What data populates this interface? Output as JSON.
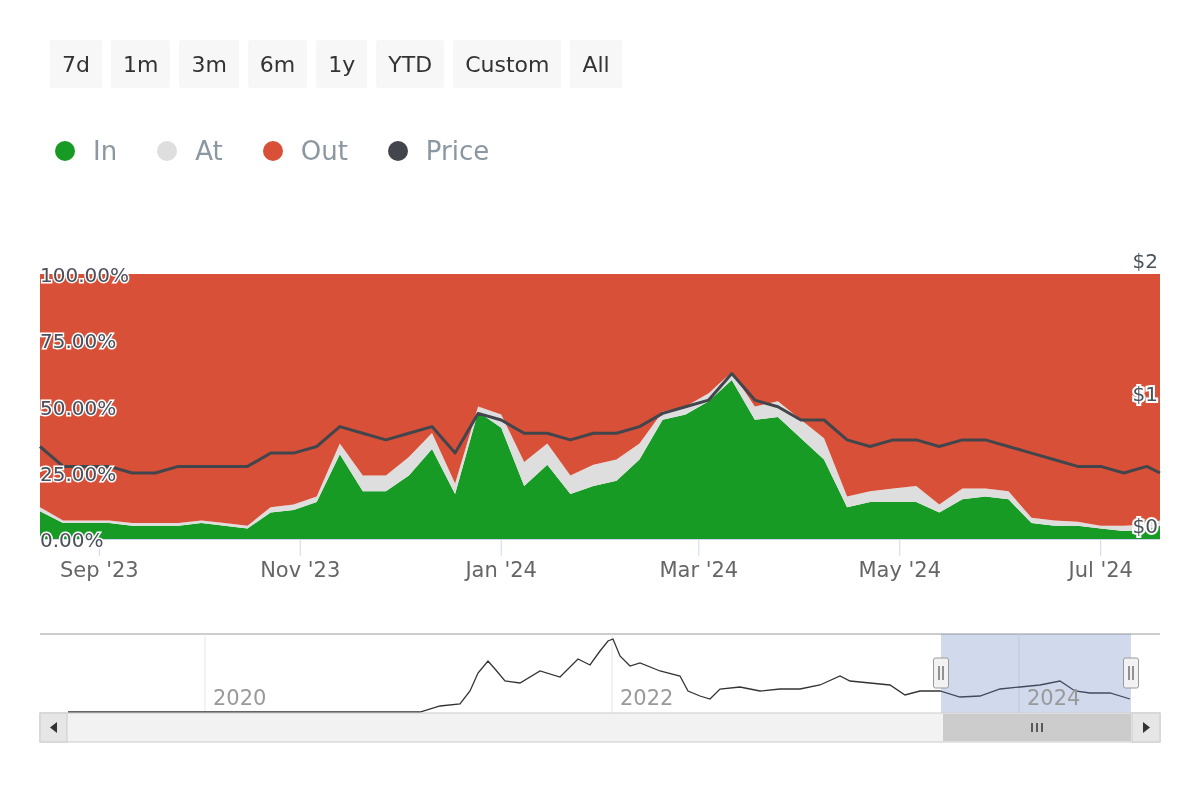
{
  "range_buttons": [
    {
      "label": "7d",
      "selected": false
    },
    {
      "label": "1m",
      "selected": false
    },
    {
      "label": "3m",
      "selected": false
    },
    {
      "label": "6m",
      "selected": false
    },
    {
      "label": "1y",
      "selected": false
    },
    {
      "label": "YTD",
      "selected": false
    },
    {
      "label": "Custom",
      "selected": false
    },
    {
      "label": "All",
      "selected": false
    }
  ],
  "chart": {
    "chart_data": {
      "type": "area",
      "stacked": true,
      "x": [
        "2023-08-14",
        "2023-08-21",
        "2023-08-28",
        "2023-09-04",
        "2023-09-11",
        "2023-09-18",
        "2023-09-25",
        "2023-10-02",
        "2023-10-09",
        "2023-10-16",
        "2023-10-23",
        "2023-10-30",
        "2023-11-06",
        "2023-11-13",
        "2023-11-20",
        "2023-11-27",
        "2023-12-04",
        "2023-12-11",
        "2023-12-18",
        "2023-12-25",
        "2024-01-01",
        "2024-01-08",
        "2024-01-15",
        "2024-01-22",
        "2024-01-29",
        "2024-02-05",
        "2024-02-12",
        "2024-02-19",
        "2024-02-26",
        "2024-03-04",
        "2024-03-11",
        "2024-03-18",
        "2024-03-25",
        "2024-04-01",
        "2024-04-08",
        "2024-04-15",
        "2024-04-22",
        "2024-04-29",
        "2024-05-06",
        "2024-05-13",
        "2024-05-20",
        "2024-05-27",
        "2024-06-03",
        "2024-06-10",
        "2024-06-17",
        "2024-06-24",
        "2024-07-01",
        "2024-07-08",
        "2024-07-15",
        "2024-07-19"
      ],
      "series": [
        {
          "name": "In",
          "color": "#189b24",
          "values": [
            10.5,
            6,
            6,
            6,
            5,
            5,
            5,
            6,
            5,
            4,
            10,
            11,
            14,
            32,
            18,
            18,
            24,
            34,
            17,
            48,
            42,
            20,
            28,
            17,
            20,
            22,
            30,
            45,
            47,
            52,
            60,
            45,
            46,
            38,
            30,
            12,
            14,
            14,
            14,
            10,
            15,
            16,
            15,
            6,
            5,
            5,
            4,
            3,
            3.5,
            5
          ]
        },
        {
          "name": "At",
          "color": "#dedede",
          "values": [
            1.5,
            1,
            1,
            1,
            1,
            1,
            1,
            1,
            1,
            1,
            2,
            2,
            2,
            4,
            6,
            6,
            7,
            6,
            4,
            2,
            5,
            9,
            8,
            7,
            8,
            8,
            6,
            3,
            3,
            3,
            3,
            5,
            6,
            7,
            8,
            4,
            4,
            5,
            6,
            3,
            4,
            3,
            3,
            2,
            2,
            1.5,
            1,
            2,
            2,
            2
          ]
        },
        {
          "name": "Out",
          "color": "#d95038",
          "values": [
            88,
            93,
            93,
            93,
            94,
            94,
            94,
            93,
            94,
            95,
            88,
            87,
            84,
            64,
            76,
            76,
            69,
            60,
            79,
            50,
            53,
            71,
            64,
            76,
            72,
            70,
            64,
            52,
            50,
            45,
            37,
            50,
            48,
            55,
            62,
            84,
            82,
            81,
            80,
            87,
            81,
            81,
            82,
            92,
            93,
            93.5,
            95,
            95,
            94.5,
            93
          ]
        },
        {
          "name": "Price",
          "type": "line",
          "axis": "y2",
          "color": "#42464c",
          "values": [
            0.6,
            0.45,
            0.45,
            0.45,
            0.4,
            0.4,
            0.45,
            0.45,
            0.45,
            0.45,
            0.55,
            0.55,
            0.6,
            0.75,
            0.7,
            0.65,
            0.7,
            0.75,
            0.55,
            0.85,
            0.8,
            0.7,
            0.7,
            0.65,
            0.7,
            0.7,
            0.75,
            0.85,
            0.9,
            0.95,
            1.15,
            0.95,
            0.9,
            0.8,
            0.8,
            0.65,
            0.6,
            0.65,
            0.65,
            0.6,
            0.65,
            0.65,
            0.6,
            0.55,
            0.5,
            0.45,
            0.45,
            0.4,
            0.45,
            0.4
          ]
        }
      ],
      "xlim": [
        "2023-08-14",
        "2024-07-19"
      ],
      "ylim": [
        0,
        100
      ],
      "yticks": [
        {
          "value": 0,
          "label": "0.00%"
        },
        {
          "value": 25,
          "label": "25.00%"
        },
        {
          "value": 50,
          "label": "50.00%"
        },
        {
          "value": 75,
          "label": "75.00%"
        },
        {
          "value": 100,
          "label": "100.00%"
        }
      ],
      "y2lim": [
        0,
        2
      ],
      "y2ticks": [
        {
          "value": 0,
          "label": "$0"
        },
        {
          "value": 1,
          "label": "$1"
        },
        {
          "value": 2,
          "label": "$2"
        }
      ],
      "xticks": [
        {
          "value": "2023-09-01",
          "label": "Sep '23"
        },
        {
          "value": "2023-11-01",
          "label": "Nov '23"
        },
        {
          "value": "2024-01-01",
          "label": "Jan '24"
        },
        {
          "value": "2024-03-01",
          "label": "Mar '24"
        },
        {
          "value": "2024-05-01",
          "label": "May '24"
        },
        {
          "value": "2024-07-01",
          "label": "Jul '24"
        }
      ]
    }
  },
  "navigator": {
    "year_labels": [
      "2020",
      "2022",
      "2024"
    ]
  }
}
